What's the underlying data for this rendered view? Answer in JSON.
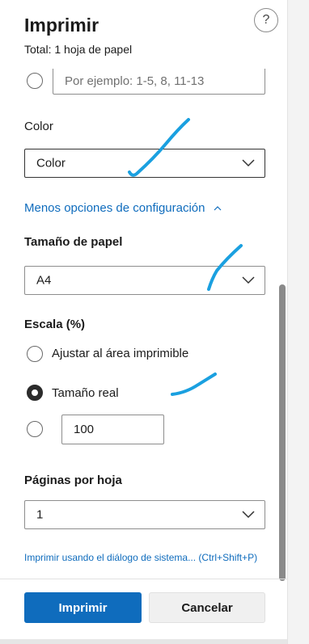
{
  "header": {
    "title": "Imprimir",
    "subtitle": "Total: 1 hoja de papel",
    "help_label": "?"
  },
  "pages_range": {
    "placeholder": "Por ejemplo: 1-5, 8, 11-13"
  },
  "color": {
    "label": "Color",
    "selected": "Color"
  },
  "less_options": {
    "label": "Menos opciones de configuración",
    "chevron": "^"
  },
  "paper_size": {
    "label": "Tamaño de papel",
    "selected": "A4"
  },
  "scale": {
    "label": "Escala (%)",
    "options": [
      {
        "label": "Ajustar al área imprimible",
        "checked": false
      },
      {
        "label": "Tamaño real",
        "checked": true
      }
    ],
    "custom_value": "100"
  },
  "pages_per_sheet": {
    "label": "Páginas por hoja",
    "selected": "1"
  },
  "system_dialog_link": "Imprimir usando el diálogo de sistema... (Ctrl+Shift+P)",
  "footer": {
    "print_label": "Imprimir",
    "cancel_label": "Cancelar"
  },
  "colors": {
    "accent": "#0f6cbd",
    "annotation": "#1aa0e0"
  }
}
